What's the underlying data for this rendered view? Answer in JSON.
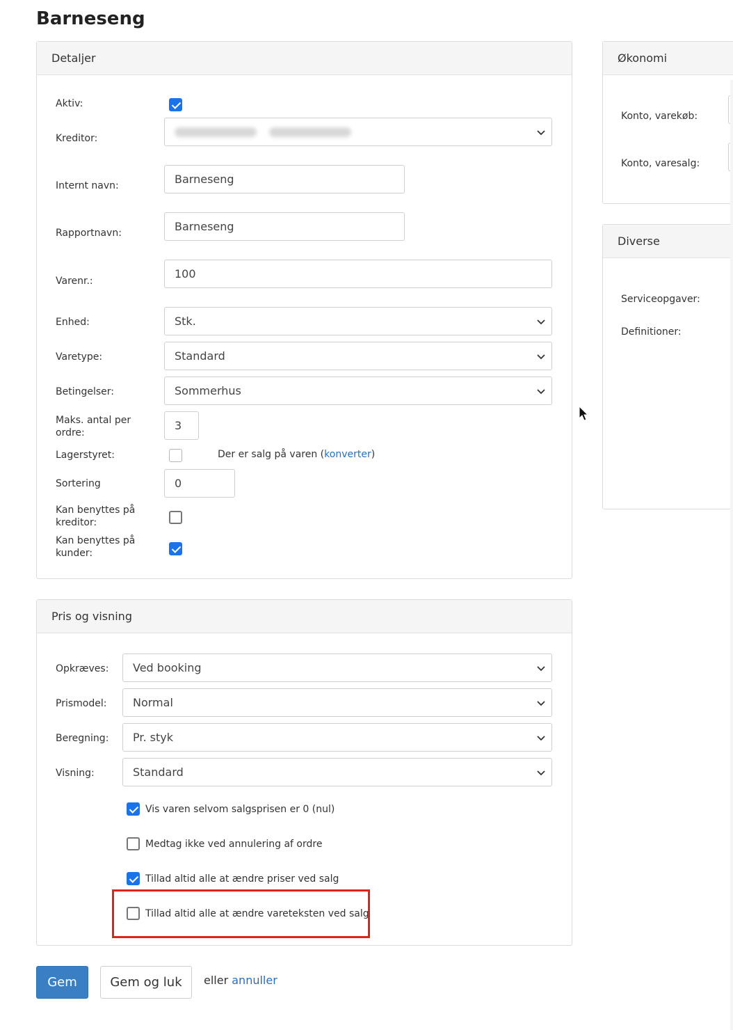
{
  "page": {
    "title": "Barneseng"
  },
  "detaljer": {
    "heading": "Detaljer",
    "aktiv_label": "Aktiv:",
    "aktiv_checked": true,
    "kreditor_label": "Kreditor:",
    "internt_navn_label": "Internt navn:",
    "internt_navn_value": "Barneseng",
    "rapportnavn_label": "Rapportnavn:",
    "rapportnavn_value": "Barneseng",
    "varenr_label": "Varenr.:",
    "varenr_value": "100",
    "enhed_label": "Enhed:",
    "enhed_value": "Stk.",
    "varetype_label": "Varetype:",
    "varetype_value": "Standard",
    "betingelser_label": "Betingelser:",
    "betingelser_value": "Sommerhus",
    "maks_label_1": "Maks. antal per",
    "maks_label_2": "ordre:",
    "maks_value": "3",
    "lagerstyret_label": "Lagerstyret:",
    "lagerstyret_checked": false,
    "salg_note": "Der er salg på varen (",
    "salg_link": "konverter",
    "salg_note_end": ")",
    "sortering_label": "Sortering",
    "sortering_value": "0",
    "kan_kreditor_label_1": "Kan benyttes på",
    "kan_kreditor_label_2": "kreditor:",
    "kan_kreditor_checked": false,
    "kan_kunder_label_1": "Kan benyttes på",
    "kan_kunder_label_2": "kunder:",
    "kan_kunder_checked": true
  },
  "pris": {
    "heading": "Pris og visning",
    "opkraeves_label": "Opkræves:",
    "opkraeves_value": "Ved booking",
    "prismodel_label": "Prismodel:",
    "prismodel_value": "Normal",
    "beregning_label": "Beregning:",
    "beregning_value": "Pr. styk",
    "visning_label": "Visning:",
    "visning_value": "Standard",
    "options": [
      {
        "label": "Vis varen selvom salgsprisen er 0 (nul)",
        "checked": true
      },
      {
        "label": "Medtag ikke ved annulering af ordre",
        "checked": false
      },
      {
        "label": "Tillad altid alle at ændre priser ved salg",
        "checked": true
      },
      {
        "label": "Tillad altid alle at ændre vareteksten ved salg",
        "checked": false
      }
    ]
  },
  "okonomi": {
    "heading": "Økonomi",
    "konto_varekob_label": "Konto, varekøb:",
    "konto_varesalg_label": "Konto, varesalg:"
  },
  "diverse": {
    "heading": "Diverse",
    "serviceopgaver_label": "Serviceopgaver:",
    "definitioner_label": "Definitioner:"
  },
  "actions": {
    "gem": "Gem",
    "gem_og_luk": "Gem og luk",
    "eller": "eller",
    "annuller": "annuller"
  },
  "colors": {
    "primary": "#3a7fc3",
    "checkbox": "#1a73e8",
    "link": "#2a6ebb",
    "highlight": "#e2231a"
  }
}
